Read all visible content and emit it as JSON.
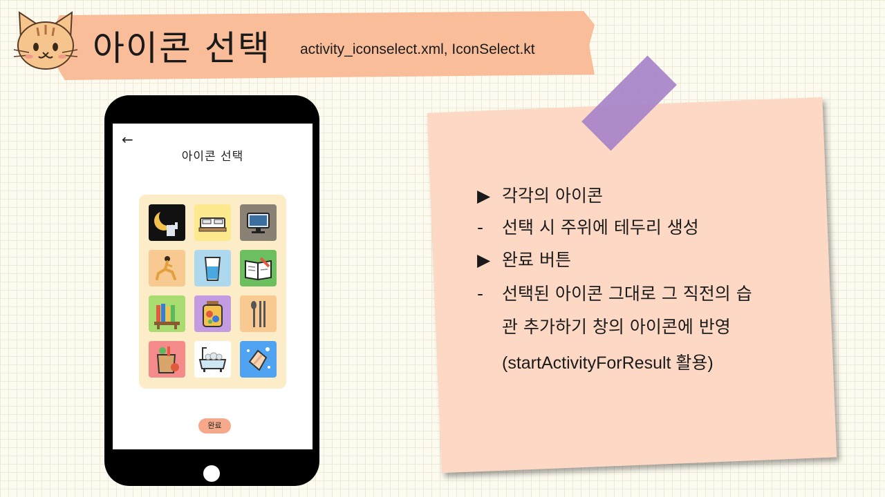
{
  "header": {
    "title": "아이콘 선택",
    "files": "activity_iconselect.xml,  IconSelect.kt"
  },
  "phone": {
    "back_icon": "←",
    "screen_title": "아이콘 선택",
    "done_label": "완료",
    "icons": [
      "moon-night-icon",
      "bed-icon",
      "monitor-icon",
      "exercise-lunge-icon",
      "water-glass-icon",
      "book-reading-icon",
      "bookshelf-icon",
      "vitamin-jar-icon",
      "chopsticks-spoon-icon",
      "grocery-bag-icon",
      "bathtub-icon",
      "hand-washing-icon"
    ]
  },
  "note": {
    "bullet1_marker": "▶",
    "bullet1": "각각의 아이콘",
    "sub1_marker": "-",
    "sub1": "선택 시 주위에 테두리 생성",
    "bullet2_marker": "▶",
    "bullet2": "완료 버튼",
    "sub2_marker": "-",
    "sub2_line1": "선택된 아이콘 그대로 그 직전의 습",
    "sub2_line2": "관 추가하기 창의 아이콘에 반영",
    "sub2_line3": "(startActivityForResult 활용)"
  },
  "colors": {
    "banner": "#f9bd9a",
    "note": "#fdd9c5",
    "tape": "#a783c9",
    "panel": "#fdecc8",
    "done_button": "#f5a98a"
  }
}
